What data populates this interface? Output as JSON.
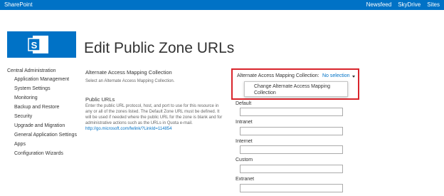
{
  "suitebar": {
    "brand": "SharePoint",
    "links": [
      "Newsfeed",
      "SkyDrive",
      "Sites"
    ]
  },
  "logo": {
    "letter": "S"
  },
  "page": {
    "title": "Edit Public Zone URLs"
  },
  "quicklaunch": {
    "header": "Central Administration",
    "items": [
      "Application Management",
      "System Settings",
      "Monitoring",
      "Backup and Restore",
      "Security",
      "Upgrade and Migration",
      "General Application Settings",
      "Apps",
      "Configuration Wizards"
    ]
  },
  "sections": {
    "amc_title": "Alternate Access Mapping Collection",
    "amc_desc": "Select an Alternate Access Mapping Collection.",
    "public_title": "Public URLs",
    "public_desc": "Enter the public URL protocol, host, and port to use for this resource in any or all of the zones listed.  The Default Zone URL must be defined.  It will be used if needed where the public URL for the zone is blank and for administrative actions such as the URLs in Quota e-mail.",
    "public_link": "http://go.microsoft.com/fwlink/?LinkId=114854"
  },
  "amc_selector": {
    "label": "Alternate Access Mapping Collection:",
    "value": "No selection",
    "menu_item": "Change Alternate Access Mapping Collection"
  },
  "zones": [
    {
      "label": "Default",
      "value": ""
    },
    {
      "label": "Intranet",
      "value": ""
    },
    {
      "label": "Internet",
      "value": ""
    },
    {
      "label": "Custom",
      "value": ""
    },
    {
      "label": "Extranet",
      "value": ""
    }
  ],
  "colors": {
    "suitebar": "#0072c6",
    "link": "#0072c6",
    "highlight_border": "#d9252c"
  },
  "icons": {
    "dropdown": "caret-down-icon",
    "logo": "sharepoint-logo-icon"
  }
}
